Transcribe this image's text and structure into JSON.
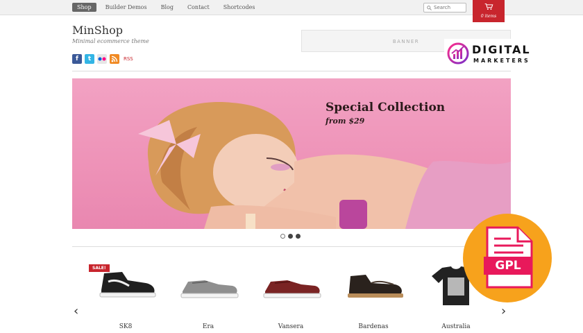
{
  "nav": {
    "items": [
      "Shop",
      "Builder Demos",
      "Blog",
      "Contact",
      "Shortcodes"
    ],
    "active": "Shop"
  },
  "search": {
    "placeholder": "Search"
  },
  "cart": {
    "label": "0 items",
    "color": "#c8252d"
  },
  "header": {
    "logo": "MinShop",
    "tagline": "Minimal ecommerce theme",
    "social": [
      "facebook-icon",
      "twitter-icon",
      "flickr-icon",
      "rss-icon"
    ],
    "rss_label": "RSS",
    "banner": "BANNER"
  },
  "watermark": {
    "line1": "DIGITAL",
    "line2": "MARKETERS"
  },
  "hero": {
    "title": "Special Collection",
    "subtitle": "from $29",
    "slides": 3,
    "active_slide": 3
  },
  "products": {
    "badge": "SALE!",
    "items": [
      {
        "name": "SK8"
      },
      {
        "name": "Era"
      },
      {
        "name": "Vansera"
      },
      {
        "name": "Bardenas"
      },
      {
        "name": "Australia"
      }
    ],
    "prev": "‹",
    "next": "›"
  },
  "gpl_badge": {
    "label": "GPL",
    "color": "#f7a21c",
    "accent": "#e8195b"
  }
}
